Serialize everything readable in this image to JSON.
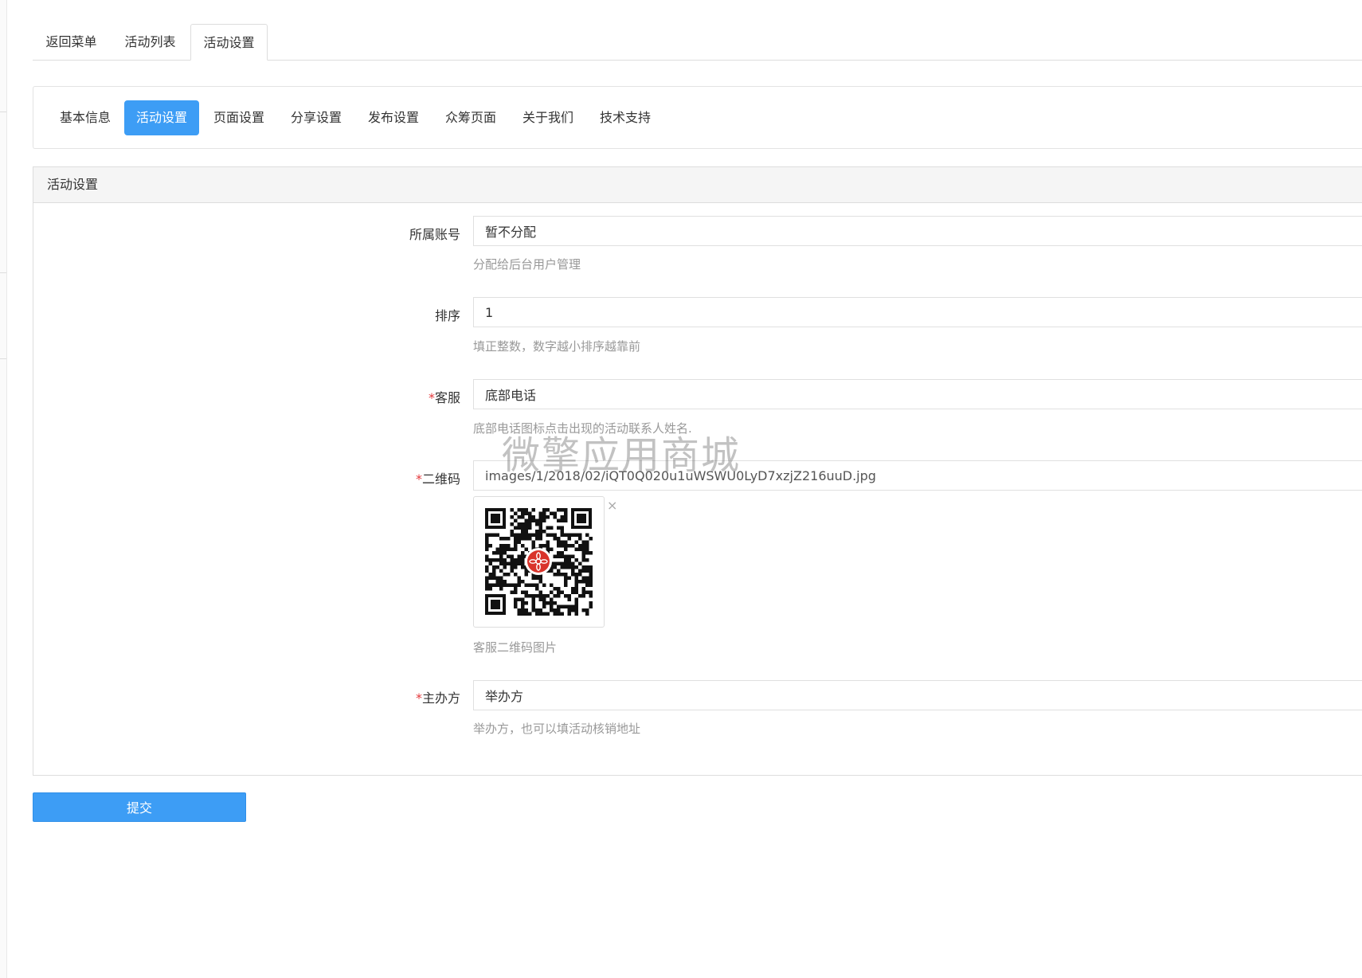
{
  "top_tabs": [
    {
      "label": "返回菜单"
    },
    {
      "label": "活动列表"
    },
    {
      "label": "活动设置",
      "active": true
    }
  ],
  "sub_nav": [
    {
      "label": "基本信息"
    },
    {
      "label": "活动设置",
      "active": true
    },
    {
      "label": "页面设置"
    },
    {
      "label": "分享设置"
    },
    {
      "label": "发布设置"
    },
    {
      "label": "众筹页面"
    },
    {
      "label": "关于我们"
    },
    {
      "label": "技术支持"
    }
  ],
  "panel": {
    "title": "活动设置",
    "fields": {
      "account": {
        "label": "所属账号",
        "value": "暂不分配",
        "help": "分配给后台用户管理"
      },
      "sort": {
        "label": "排序",
        "value": "1",
        "help": "填正整数，数字越小排序越靠前"
      },
      "service": {
        "required_mark": "*",
        "label": "客服",
        "value": "底部电话",
        "help": "底部电话图标点击出现的活动联系人姓名."
      },
      "qrcode": {
        "required_mark": "*",
        "label": "二维码",
        "value": "images/1/2018/02/iQT0Q020u1uWSWU0LyD7xzjZ216uuD.jpg",
        "help": "客服二维码图片",
        "remove_icon": "×"
      },
      "organizer": {
        "required_mark": "*",
        "label": "主办方",
        "value": "举办方",
        "help": "举办方，也可以填活动核销地址"
      }
    }
  },
  "watermark": "微擎应用商城",
  "submit_label": "提交",
  "colors": {
    "accent": "#3d9df5",
    "required": "#e4393c",
    "help_text": "#999999",
    "qr_logo": "#d9342b"
  }
}
